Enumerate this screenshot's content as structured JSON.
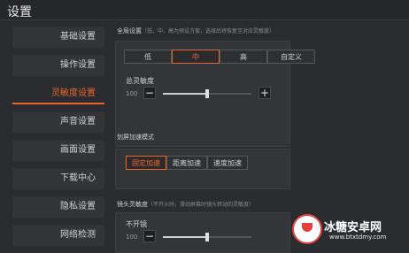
{
  "window": {
    "title": "设置"
  },
  "sidebar": {
    "items": [
      {
        "label": "基础设置",
        "active": false
      },
      {
        "label": "操作设置",
        "active": false
      },
      {
        "label": "灵敏度设置",
        "active": true
      },
      {
        "label": "声音设置",
        "active": false
      },
      {
        "label": "画面设置",
        "active": false
      },
      {
        "label": "下载中心",
        "active": false
      },
      {
        "label": "隐私设置",
        "active": false
      },
      {
        "label": "网络检测",
        "active": false
      }
    ]
  },
  "global": {
    "heading": "全局设置",
    "note": "（低、中、高为预设方案，选择后将恢复至对应灵敏度）",
    "presets": [
      "低",
      "中",
      "高",
      "自定义"
    ],
    "selected_preset": "中",
    "overall_label": "总灵敏度",
    "overall_value": "100",
    "overall_level": 0.5,
    "minus": "−",
    "plus": "+"
  },
  "scroll_accel": {
    "heading": "划屏加速模式",
    "options": [
      "固定加速",
      "距离加速",
      "速度加速"
    ],
    "selected": "固定加速"
  },
  "lens": {
    "heading": "镜头灵敏度",
    "note": "（不开火时，滑动屏幕时镜头转动的灵敏度）",
    "no_scope_label": "不开镜",
    "no_scope_value": "100",
    "no_scope_level": 0.5,
    "minus": "−"
  },
  "watermark": {
    "brand": "冰糖安卓网",
    "url": "www.btxtdmy.com"
  },
  "colors": {
    "accent": "#e8652a",
    "background": "#2b2c2f"
  }
}
